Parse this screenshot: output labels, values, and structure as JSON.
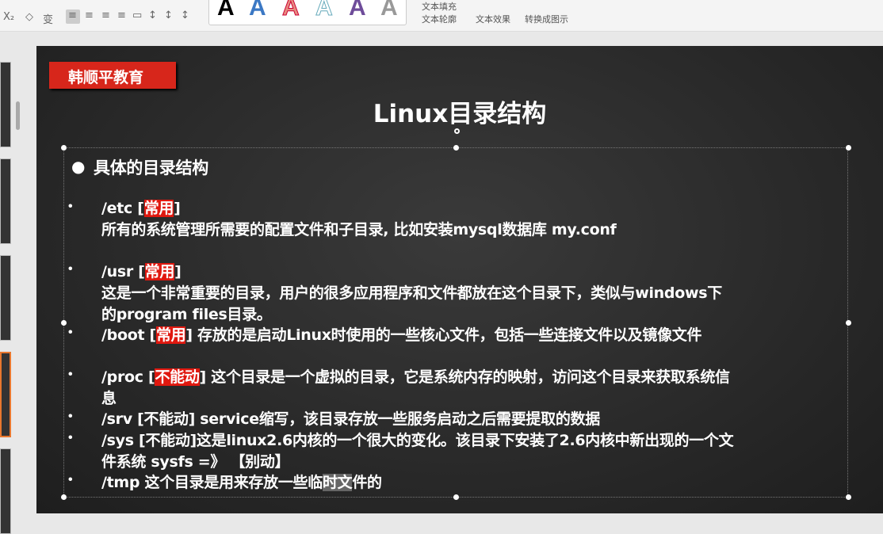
{
  "ribbon": {
    "text_fill": "文本填充",
    "text_outline": "文本轮廓",
    "text_effect": "文本效果",
    "convert_smartart": "转换成图示",
    "style_letters": [
      "A",
      "A",
      "A",
      "A",
      "A",
      "A"
    ]
  },
  "slide": {
    "logo": "韩顺平教育",
    "title": "Linux目录结构",
    "heading": "具体的目录结构",
    "items": [
      {
        "dir": "/etc",
        "pre": " [",
        "tag": "常用",
        "post": "]",
        "lines": [
          "所有的系统管理所需要的配置文件和子目录, 比如安装mysql数据库 my.conf"
        ]
      },
      {
        "dir": "/usr",
        "pre": "  [",
        "tag": "常用",
        "post": "]",
        "lines": [
          "这是一个非常重要的目录，用户的很多应用程序和文件都放在这个目录下，类似与windows下",
          "的program files目录。"
        ]
      },
      {
        "dir": "/boot",
        "pre": " [",
        "tag": "常用",
        "post": "] 存放的是启动Linux时使用的一些核心文件，包括一些连接文件以及镜像文件",
        "lines": []
      },
      {
        "dir": "/proc",
        "pre": " [",
        "tag": "不能动",
        "post": "] 这个目录是一个虚拟的目录，它是系统内存的映射，访问这个目录来获取系统信",
        "lines": [
          "息"
        ]
      },
      {
        "text": "/srv [不能动]  service缩写，该目录存放一些服务启动之后需要提取的数据"
      },
      {
        "text": "/sys  [不能动]这是linux2.6内核的一个很大的变化。该目录下安装了2.6内核中新出现的一个文",
        "line2": "件系统 sysfs =》 【别动】"
      },
      {
        "pre": "/tmp 这个目录是用来存放一些临",
        "hl": "时文",
        "post": "件的"
      }
    ]
  },
  "colors": {
    "accent": "#e0180f",
    "background": "#262626"
  }
}
